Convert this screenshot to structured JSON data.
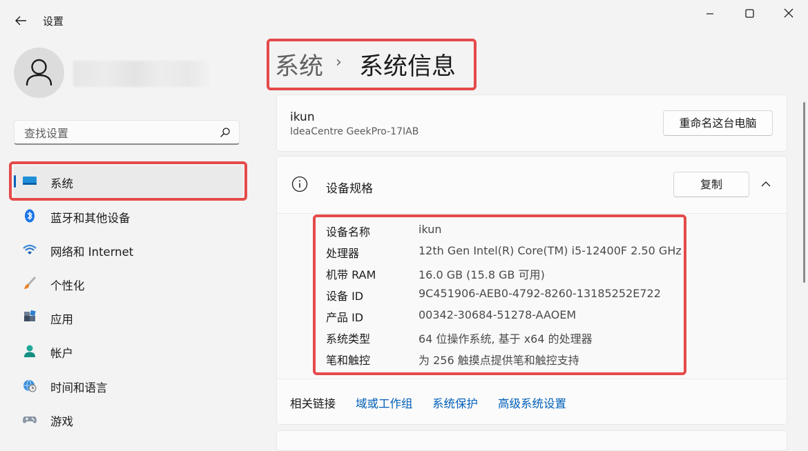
{
  "app": {
    "title": "设置"
  },
  "search": {
    "placeholder": "查找设置"
  },
  "nav": {
    "items": [
      {
        "label": "系统",
        "icon": "monitor-icon",
        "active": true
      },
      {
        "label": "蓝牙和其他设备",
        "icon": "bluetooth-icon"
      },
      {
        "label": "网络和 Internet",
        "icon": "wifi-icon"
      },
      {
        "label": "个性化",
        "icon": "brush-icon"
      },
      {
        "label": "应用",
        "icon": "apps-icon"
      },
      {
        "label": "帐户",
        "icon": "account-icon"
      },
      {
        "label": "时间和语言",
        "icon": "globe-clock-icon"
      },
      {
        "label": "游戏",
        "icon": "gamepad-icon"
      }
    ]
  },
  "breadcrumb": {
    "parent": "系统",
    "separator": "›",
    "current": "系统信息"
  },
  "device_card": {
    "name": "ikun",
    "model": "IdeaCentre GeekPro-17IAB",
    "rename_label": "重命名这台电脑"
  },
  "specs": {
    "title": "设备规格",
    "copy_label": "复制",
    "rows": [
      {
        "key": "设备名称",
        "value": "ikun"
      },
      {
        "key": "处理器",
        "value": "12th Gen Intel(R) Core(TM) i5-12400F   2.50 GHz"
      },
      {
        "key": "机带 RAM",
        "value": "16.0 GB (15.8 GB 可用)"
      },
      {
        "key": "设备 ID",
        "value": "9C451906-AEB0-4792-8260-13185252E722"
      },
      {
        "key": "产品 ID",
        "value": "00342-30684-51278-AAOEM"
      },
      {
        "key": "系统类型",
        "value": "64 位操作系统, 基于 x64 的处理器"
      },
      {
        "key": "笔和触控",
        "value": "为 256 触摸点提供笔和触控支持"
      }
    ]
  },
  "related": {
    "label": "相关链接",
    "links": [
      "域或工作组",
      "系统保护",
      "高级系统设置"
    ]
  },
  "colors": {
    "accent": "#005fb8",
    "highlight": "#e54a4a",
    "background": "#f3f3f3",
    "card": "#fbfbfb"
  }
}
